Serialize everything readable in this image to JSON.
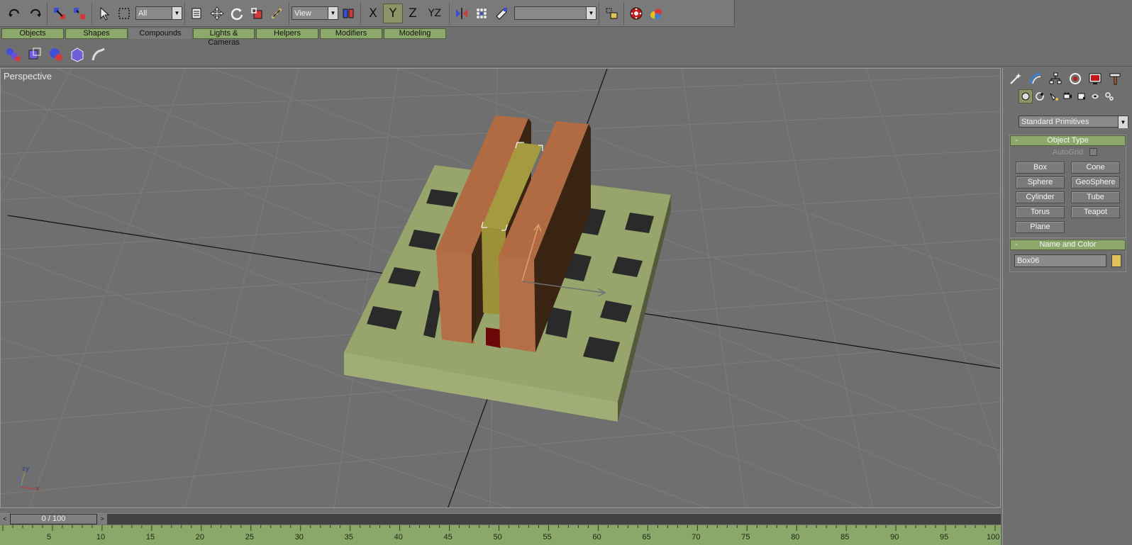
{
  "toolbar": {
    "selection_filter": "All",
    "ref_coord_system": "View",
    "named_selection": "",
    "axis_x": "X",
    "axis_y": "Y",
    "axis_z": "Z",
    "axis_yz": "YZ",
    "active_axis": "Y"
  },
  "tabs": [
    {
      "label": "Objects"
    },
    {
      "label": "Shapes"
    },
    {
      "label": "Compounds"
    },
    {
      "label": "Lights & Cameras"
    },
    {
      "label": "Helpers"
    },
    {
      "label": "Modifiers"
    },
    {
      "label": "Modeling"
    }
  ],
  "active_tab": "Compounds",
  "viewport": {
    "label": "Perspective",
    "gizmo_y": "y",
    "gizmo_z": "z",
    "gizmo_x": "x"
  },
  "command_panel": {
    "category": "Standard Primitives",
    "object_type": {
      "title": "Object Type",
      "autogrid_label": "AutoGrid",
      "autogrid_checked": false,
      "buttons": [
        "Box",
        "Cone",
        "Sphere",
        "GeoSphere",
        "Cylinder",
        "Tube",
        "Torus",
        "Teapot",
        "Plane"
      ]
    },
    "name_and_color": {
      "title": "Name and Color",
      "name": "Box06",
      "color": "#e0c25a"
    },
    "rollout_collapse_symbol": "-"
  },
  "time_slider": {
    "value": "0 / 100",
    "prev_arrow": "<",
    "next_arrow": ">"
  },
  "track_bar": {
    "tick_labels": [
      "5",
      "10",
      "15",
      "20",
      "25",
      "30",
      "35",
      "40",
      "45",
      "50",
      "55",
      "60",
      "65",
      "70",
      "75",
      "80",
      "85",
      "90",
      "95",
      "100"
    ]
  },
  "colors": {
    "tab_green": "#8da86b",
    "base_green": "#97a46b",
    "wall_orange": "#b06b42",
    "selected_yellow": "#a59a40",
    "viewport_gray": "#6f6f6f"
  }
}
